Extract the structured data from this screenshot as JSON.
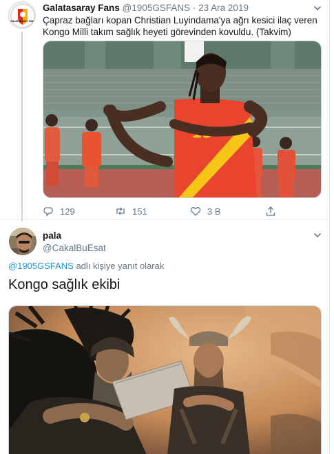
{
  "tweet1": {
    "author_name": "Galatasaray Fans",
    "author_handle": "@1905GSFANS",
    "separator": "·",
    "date": "23 Ara 2019",
    "text": "Çapraz bağları kopan Christian Luyindama'ya ağrı kesici ilaç veren Kongo Milli takım sağlık heyeti görevinden kovuldu. (Takvim)",
    "avatar_label": "GALATASARAY FANS",
    "player_number": "15",
    "actions": {
      "replies": "129",
      "retweets": "151",
      "likes": "3 B"
    }
  },
  "tweet2": {
    "author_name": "pala",
    "author_handle": "@CakalBuEsat",
    "reply_mention": "@1905GSFANS",
    "reply_suffix": " adlı kişiye yanıt olarak",
    "text": "Kongo sağlık ekibi"
  },
  "colors": {
    "text_primary": "#14171a",
    "text_secondary": "#657786",
    "link": "#1b95e0",
    "border": "#e6ecf0",
    "jersey_red": "#e8442e",
    "jersey_yellow": "#f5c518"
  }
}
